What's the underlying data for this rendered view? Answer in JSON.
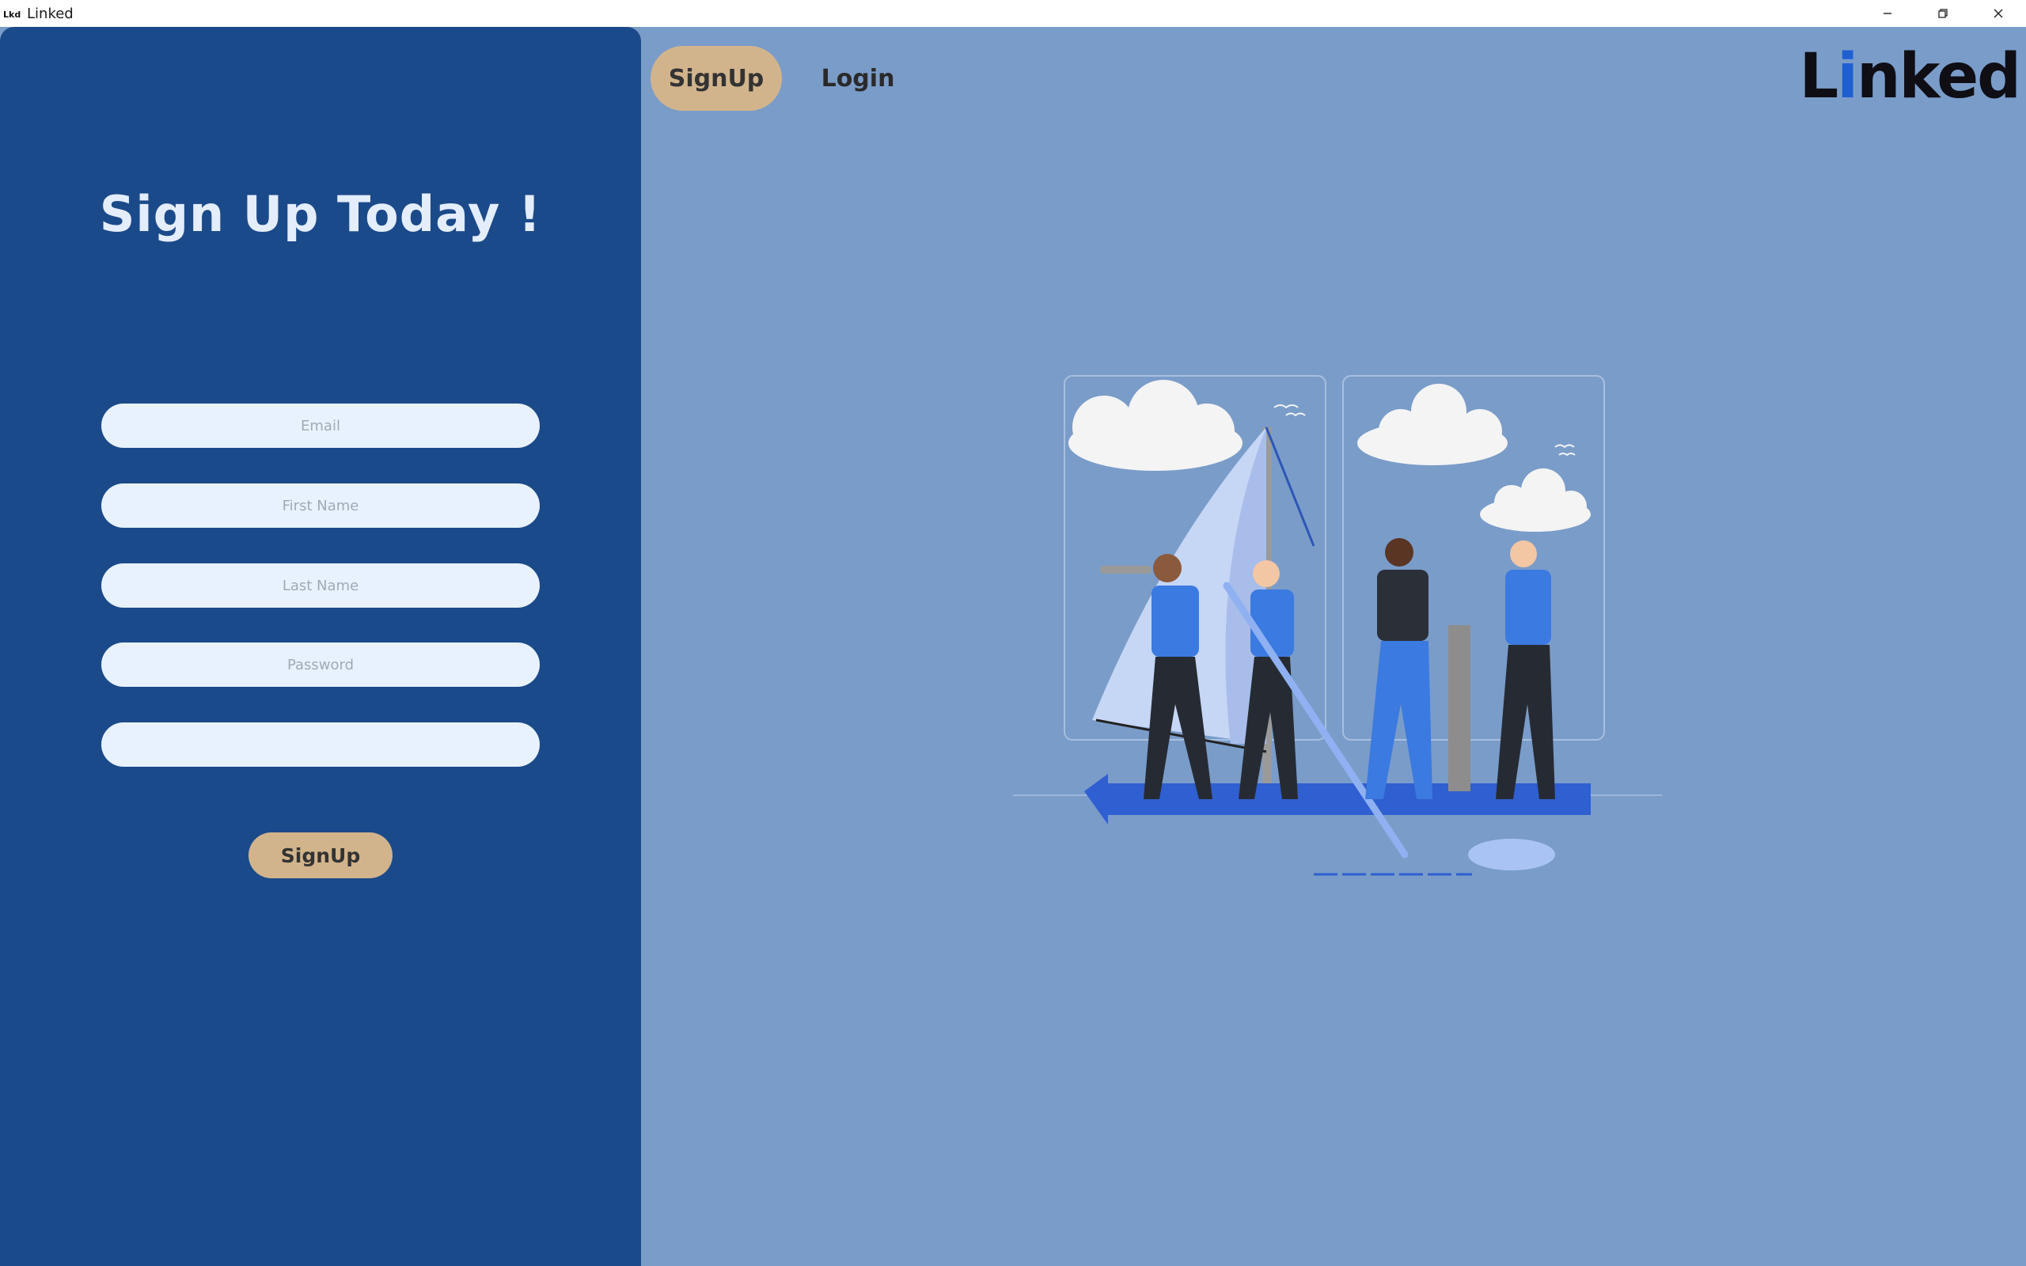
{
  "window": {
    "title": "Linked",
    "icon": "app-logo-icon",
    "controls": [
      "minimize-icon",
      "maximize-icon",
      "close-icon"
    ]
  },
  "nav": {
    "signup_tab": "SignUp",
    "login_tab": "Login"
  },
  "brand": {
    "prefix": "L",
    "accent": "i",
    "suffix": "nked",
    "accent_color": "#1f5fd1"
  },
  "form": {
    "heading": "Sign Up Today !",
    "email_placeholder": "Email",
    "first_name_placeholder": "First Name",
    "last_name_placeholder": "Last Name",
    "password_placeholder": "Password",
    "extra_field_placeholder": "",
    "submit_label": "SignUp"
  },
  "colors": {
    "panel": "#1b4a8a",
    "background": "#7a9cc9",
    "button": "#d2b48c",
    "field": "#e8f2ff",
    "heading": "#e4edfb"
  },
  "illustration": {
    "subject": "team-sailing-illustration"
  }
}
